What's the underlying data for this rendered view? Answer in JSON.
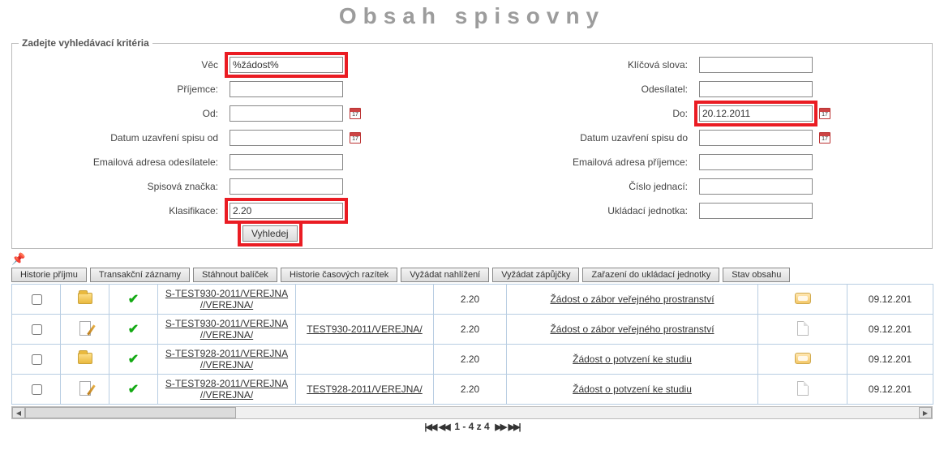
{
  "page": {
    "title": "Obsah spisovny"
  },
  "criteria": {
    "legend": "Zadejte vyhledávací kritéria",
    "fields": {
      "vec": {
        "label": "Věc",
        "value": "%žádost%"
      },
      "klicova": {
        "label": "Klíčová slova:",
        "value": ""
      },
      "prijemce": {
        "label": "Příjemce:",
        "value": ""
      },
      "odesilatel": {
        "label": "Odesílatel:",
        "value": ""
      },
      "od": {
        "label": "Od:",
        "value": ""
      },
      "do": {
        "label": "Do:",
        "value": "20.12.2011"
      },
      "dus_od": {
        "label": "Datum uzavření spisu od",
        "value": ""
      },
      "dus_do": {
        "label": "Datum uzavření spisu do",
        "value": ""
      },
      "email_odes": {
        "label": "Emailová adresa odesílatele:",
        "value": ""
      },
      "email_prij": {
        "label": "Emailová adresa příjemce:",
        "value": ""
      },
      "spis_znacka": {
        "label": "Spisová značka:",
        "value": ""
      },
      "cj": {
        "label": "Číslo jednací:",
        "value": ""
      },
      "klasifikace": {
        "label": "Klasifikace:",
        "value": "2.20"
      },
      "ukladaci": {
        "label": "Ukládací jednotka:",
        "value": ""
      }
    },
    "search_button": "Vyhledej",
    "calendar_glyph": "17"
  },
  "toolbar": {
    "buttons": [
      "Historie příjmu",
      "Transakční záznamy",
      "Stáhnout balíček",
      "Historie časových razítek",
      "Vyžádat nahlížení",
      "Vyžádat zápůjčky",
      "Zařazení do ukládací jednotky",
      "Stav obsahu"
    ]
  },
  "results": {
    "rows": [
      {
        "type": "folder",
        "status": "ok",
        "spis": "S-TEST930-2011/VEREJNA //VEREJNA/",
        "cj": "",
        "klas": "2.20",
        "subj": "Žádost o zábor veřejného prostranství",
        "unit": "used",
        "date": "09.12.201"
      },
      {
        "type": "doc",
        "status": "ok",
        "spis": "S-TEST930-2011/VEREJNA //VEREJNA/",
        "cj": "TEST930-2011/VEREJNA/",
        "klas": "2.20",
        "subj": "Žádost o zábor veřejného prostranství",
        "unit": "empty",
        "date": "09.12.201"
      },
      {
        "type": "folder",
        "status": "ok",
        "spis": "S-TEST928-2011/VEREJNA //VEREJNA/",
        "cj": "",
        "klas": "2.20",
        "subj": "Žádost o potvzení ke studiu",
        "unit": "used",
        "date": "09.12.201"
      },
      {
        "type": "doc",
        "status": "ok",
        "spis": "S-TEST928-2011/VEREJNA //VEREJNA/",
        "cj": "TEST928-2011/VEREJNA/",
        "klas": "2.20",
        "subj": "Žádost o potvzení ke studiu",
        "unit": "empty",
        "date": "09.12.201"
      }
    ]
  },
  "pager": {
    "first": "|◀◀",
    "prev": "◀◀",
    "text": "1 - 4 z 4",
    "next": "▶▶",
    "last": "▶▶|"
  }
}
